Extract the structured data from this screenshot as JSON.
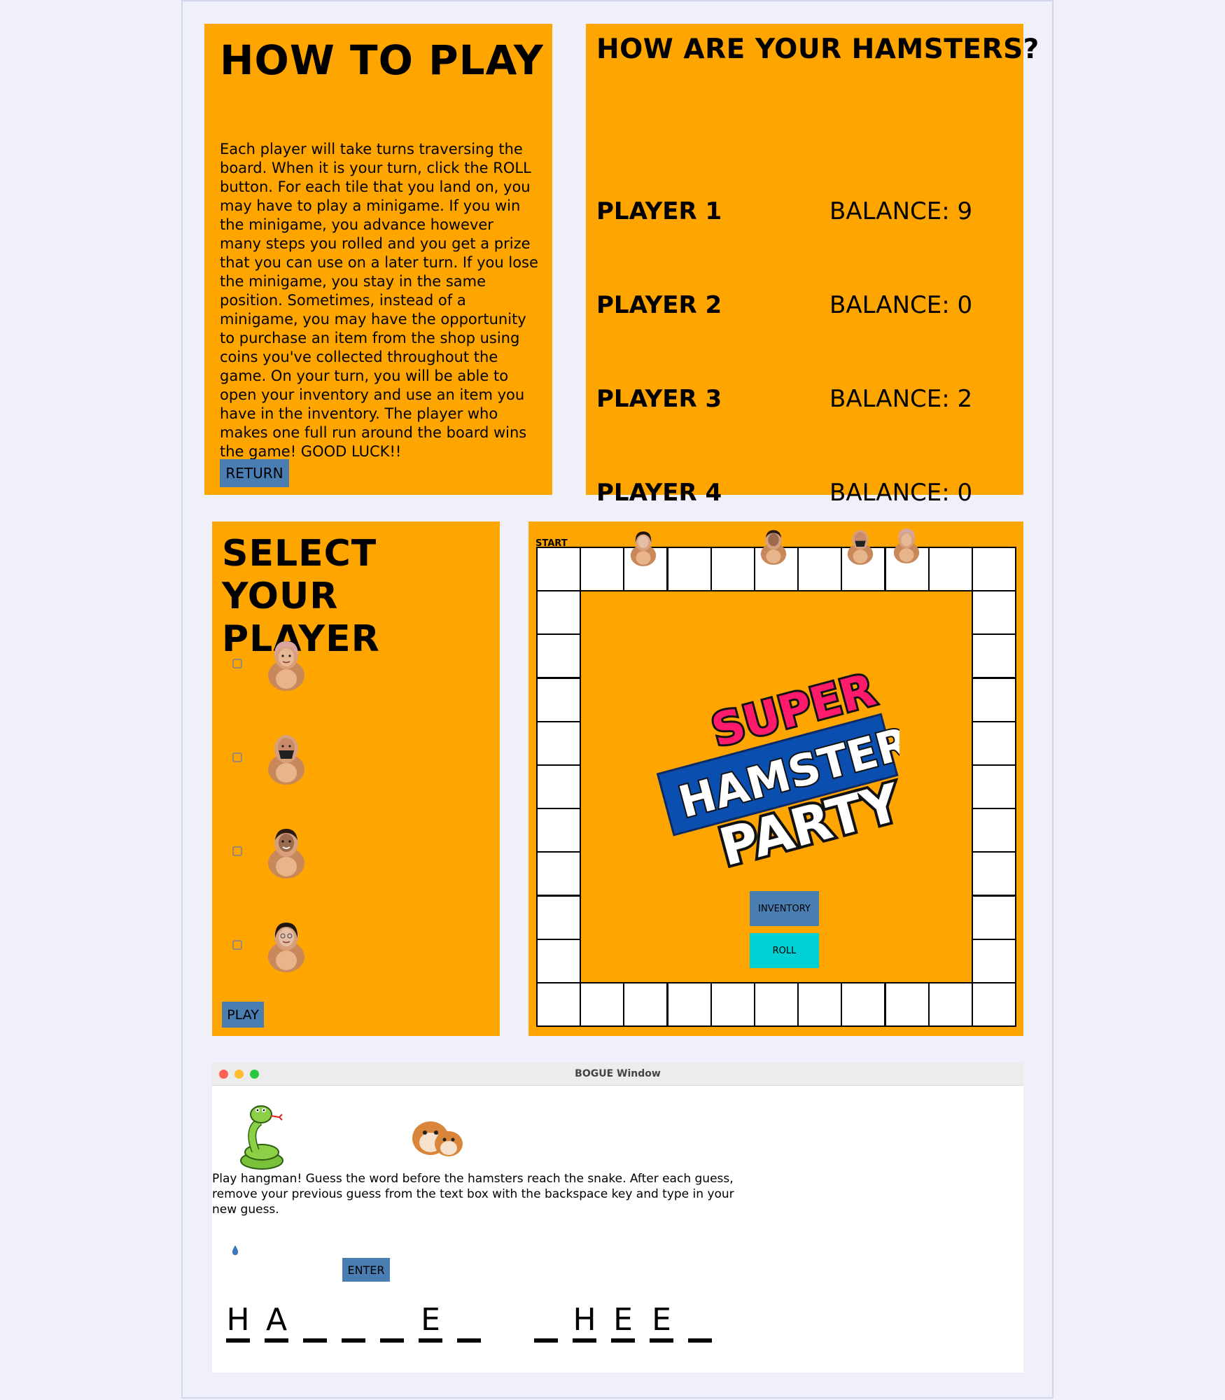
{
  "howto": {
    "title": "HOW TO PLAY",
    "text": "Each player will take turns traversing the board. When it is your turn, click the ROLL button. For each tile that you land on, you may have to play a minigame. If you win the minigame, you advance however many steps you rolled and you get a prize that you can use on a later turn. If you lose the minigame, you stay in the same position. Sometimes, instead of a minigame, you may have the opportunity to purchase an item from the shop using coins you've collected throughout the game. On your turn, you will be able to open your inventory and use an item you have in the inventory. The player who makes one full run around the board wins the game! GOOD LUCK!!",
    "return_label": "RETURN"
  },
  "status": {
    "title": "HOW ARE YOUR HAMSTERS?",
    "players": [
      {
        "name": "PLAYER 1",
        "balance": "BALANCE: 9"
      },
      {
        "name": "PLAYER 2",
        "balance": "BALANCE: 0"
      },
      {
        "name": "PLAYER 3",
        "balance": "BALANCE: 2"
      },
      {
        "name": "PLAYER 4",
        "balance": "BALANCE: 0"
      }
    ]
  },
  "select": {
    "title": "SELECT YOUR PLAYER",
    "play_label": "PLAY"
  },
  "board": {
    "start_label": "START",
    "logo": {
      "line1": "SUPER",
      "line2": "HAMSTER",
      "line3": "PARTY"
    },
    "inventory_label": "INVENTORY",
    "roll_label": "ROLL"
  },
  "bogue": {
    "window_title": "BOGUE Window",
    "instructions": "Play hangman! Guess the word before the hamsters reach the snake. After each guess, remove your previous guess from the text box with the backspace key and type in your new guess.",
    "enter_label": "ENTER",
    "word_letters": [
      "H",
      "A",
      "",
      "",
      "",
      "E",
      "",
      "",
      "H",
      "E",
      "E",
      ""
    ]
  },
  "colors": {
    "panel": "#ffa500",
    "button_blue": "#4a7eb3",
    "roll_cyan": "#00d0d4"
  }
}
